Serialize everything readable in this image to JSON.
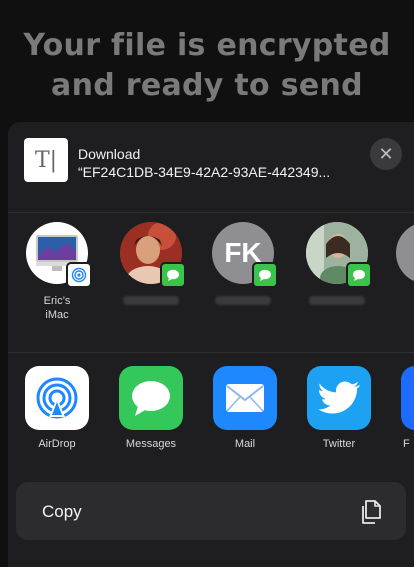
{
  "background": {
    "title": "Your file is encrypted and ready to send"
  },
  "share_sheet": {
    "file": {
      "type_glyph": "T|",
      "title": "Download",
      "name": "“EF24C1DB-34E9-42A2-93AE-442349..."
    },
    "close_glyph": "✕",
    "people": [
      {
        "kind": "device",
        "label": "Eric’s iMac",
        "badge": "airdrop-icon"
      },
      {
        "kind": "photo",
        "label": "",
        "badge": "messages-icon"
      },
      {
        "kind": "initials",
        "initials": "FK",
        "label": "",
        "badge": "messages-icon"
      },
      {
        "kind": "photo",
        "label": "",
        "badge": "messages-icon"
      }
    ],
    "apps": [
      {
        "name": "AirDrop",
        "icon": "airdrop-icon",
        "color": "#ffffff"
      },
      {
        "name": "Messages",
        "icon": "messages-icon",
        "color": "#34c759"
      },
      {
        "name": "Mail",
        "icon": "mail-icon",
        "color": "#1e88ff"
      },
      {
        "name": "Twitter",
        "icon": "twitter-icon",
        "color": "#1da1f2"
      },
      {
        "name": "F",
        "icon": "app-icon",
        "color": "#1e6cff"
      }
    ],
    "copy_action": {
      "label": "Copy",
      "icon": "copy-icon"
    }
  }
}
